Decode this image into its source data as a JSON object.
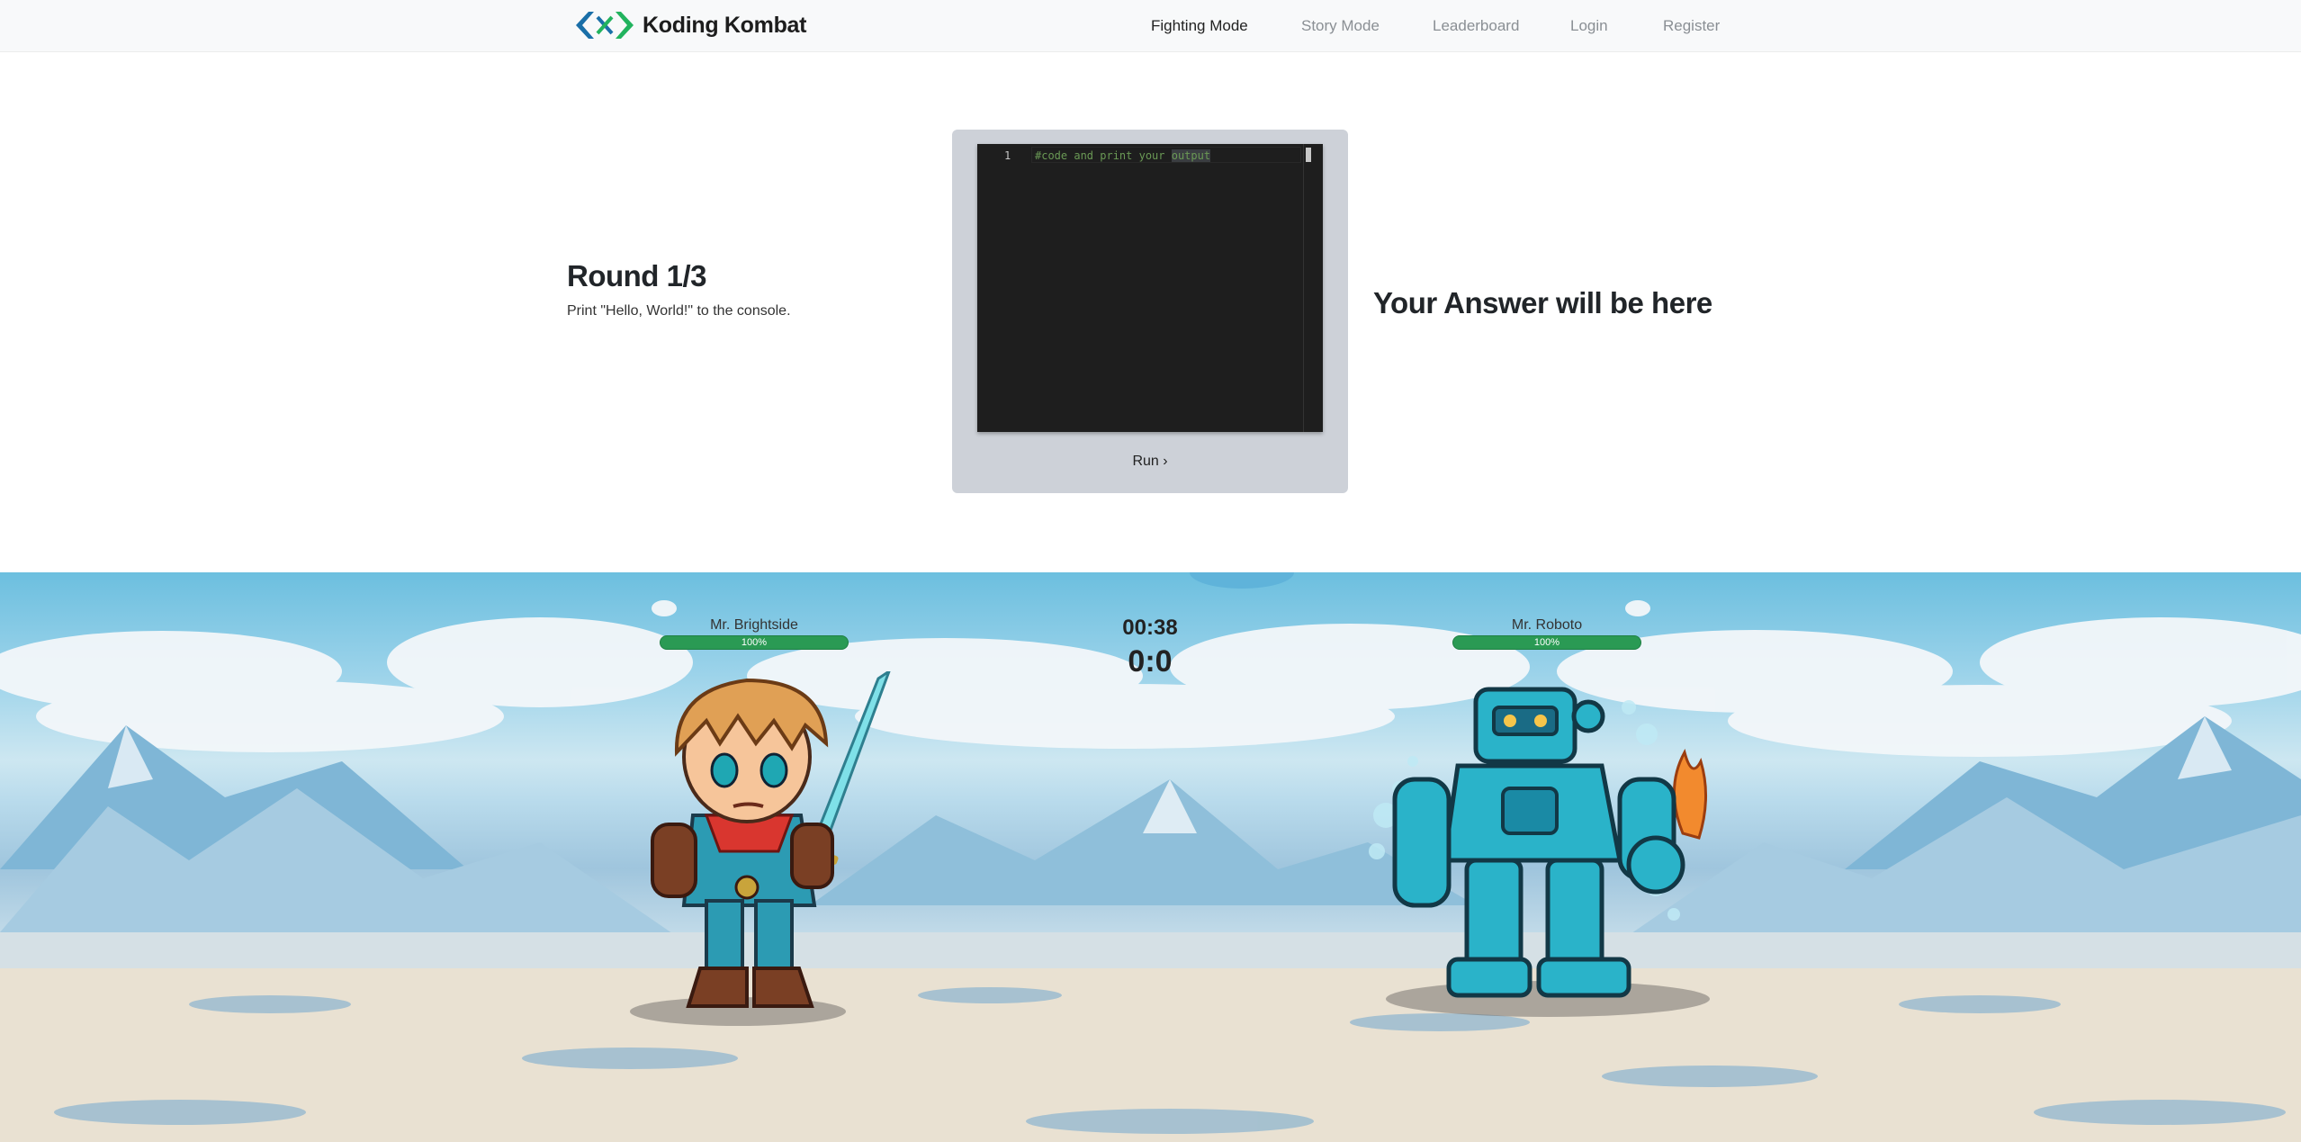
{
  "brand": {
    "name": "Koding Kombat",
    "logo_icon": "chevron-x-logo-icon"
  },
  "nav": {
    "items": [
      {
        "label": "Fighting Mode",
        "active": true
      },
      {
        "label": "Story Mode",
        "active": false
      },
      {
        "label": "Leaderboard",
        "active": false
      },
      {
        "label": "Login",
        "active": false
      },
      {
        "label": "Register",
        "active": false
      }
    ]
  },
  "round": {
    "title": "Round 1/3",
    "task": "Print \"Hello, World!\" to the console."
  },
  "editor": {
    "line_number": "1",
    "code_prefix": "#code and print your ",
    "code_highlight": "output",
    "run_label": "Run ›"
  },
  "answer": {
    "placeholder": "Your Answer will be here"
  },
  "battle": {
    "timer": "00:38",
    "score": "0:0",
    "player": {
      "name": "Mr. Brightside",
      "hp_label": "100%",
      "hp": 1.0
    },
    "opponent": {
      "name": "Mr. Roboto",
      "hp_label": "100%",
      "hp": 1.0
    }
  },
  "colors": {
    "hp_green": "#2a9a54",
    "logo_blue": "#1a6fa8",
    "logo_green": "#22b35e",
    "editor_bg": "#1e1e1e",
    "comment_green": "#6a9955"
  }
}
